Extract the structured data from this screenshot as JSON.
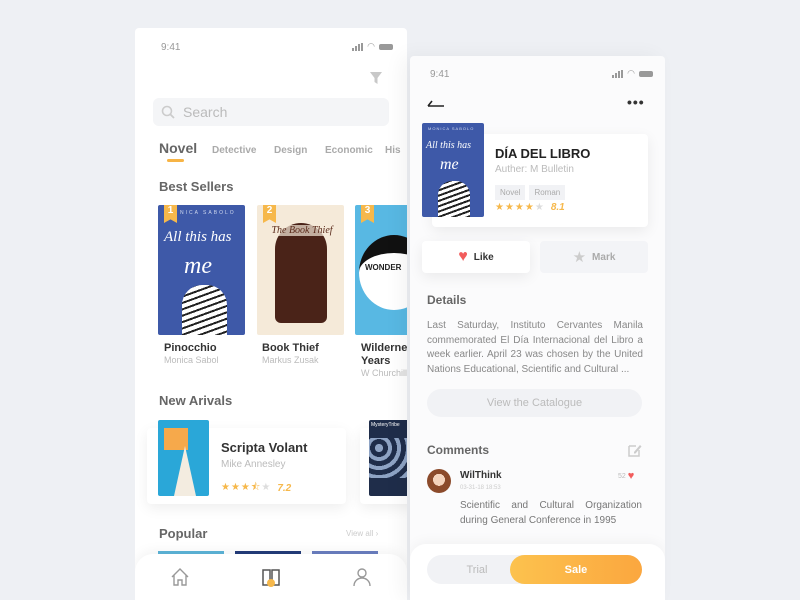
{
  "colors": {
    "accent": "#f6b84b",
    "like": "#f25c5c",
    "background": "#eef0f4"
  },
  "left": {
    "status_time": "9:41",
    "filter_icon": "filter-icon",
    "search": {
      "placeholder": "Search"
    },
    "tabs": [
      {
        "label": "Novel",
        "active": true
      },
      {
        "label": "Detective"
      },
      {
        "label": "Design"
      },
      {
        "label": "Economic"
      },
      {
        "label": "His"
      }
    ],
    "best_sellers": {
      "title": "Best Sellers",
      "books": [
        {
          "rank": "1",
          "title": "Pinocchio",
          "author": "Monica Sabol",
          "cover_text": "All this has",
          "cover_sub": "NICA SABOLO",
          "cover_me": "me"
        },
        {
          "rank": "2",
          "title": "Book Thief",
          "author": "Markus Zusak",
          "cover_text": "The Book Thief"
        },
        {
          "rank": "3",
          "title": "Wilderness Years",
          "author": "W Churchill",
          "cover_text": "WONDER"
        }
      ]
    },
    "new_arrivals": {
      "title": "New Arivals",
      "items": [
        {
          "title": "Scripta Volant",
          "author": "Mike Annesley",
          "rating": 3.5,
          "score": "7.2"
        },
        {
          "cover_text": "MysteryTribe"
        }
      ]
    },
    "popular": {
      "title": "Popular",
      "view_all": "View all ›"
    },
    "nav": [
      {
        "icon": "home-icon"
      },
      {
        "icon": "book-icon",
        "active": true
      },
      {
        "icon": "user-icon"
      }
    ]
  },
  "right": {
    "status_time": "9:41",
    "book": {
      "title": "DÍA DEL LIBRO",
      "author": "Auther:  M Bulletin",
      "tags": [
        "Novel",
        "Roman"
      ],
      "rating": 4,
      "score": "8.1",
      "cover_text": "All this has",
      "cover_sub": "MONICA SABOLO",
      "cover_me": "me"
    },
    "like_label": "Like",
    "mark_label": "Mark",
    "details": {
      "title": "Details",
      "text": "Last Saturday, Instituto Cervantes Manila commemorated El Día Internacional del Libro a week earlier. April 23 was chosen by the United Nations Educational, Scientific and Cultural ...",
      "button": "View the Catalogue"
    },
    "comments": {
      "title": "Comments",
      "items": [
        {
          "user": "WilThink",
          "date": "03-31-18 18:53",
          "likes": "52",
          "text": "Scientific and Cultural Organization during General Conference in 1995"
        }
      ]
    },
    "trial_label": "Trial",
    "sale_label": "Sale"
  }
}
